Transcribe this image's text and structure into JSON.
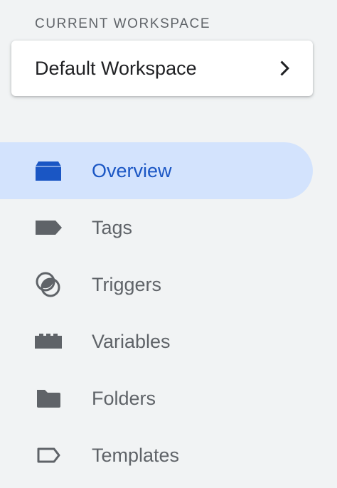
{
  "workspace": {
    "section_label": "CURRENT WORKSPACE",
    "name": "Default Workspace"
  },
  "nav": {
    "active": "Overview",
    "items": [
      {
        "label": "Overview",
        "icon": "overview-icon"
      },
      {
        "label": "Tags",
        "icon": "tag-icon"
      },
      {
        "label": "Triggers",
        "icon": "trigger-icon"
      },
      {
        "label": "Variables",
        "icon": "variables-icon"
      },
      {
        "label": "Folders",
        "icon": "folder-icon"
      },
      {
        "label": "Templates",
        "icon": "template-icon"
      }
    ]
  },
  "colors": {
    "background": "#f1f3f4",
    "active_bg": "#d3e3fd",
    "active_text": "#1a56c4",
    "text": "#5f6368",
    "icon": "#5f6368",
    "active_icon": "#1a56c4"
  }
}
